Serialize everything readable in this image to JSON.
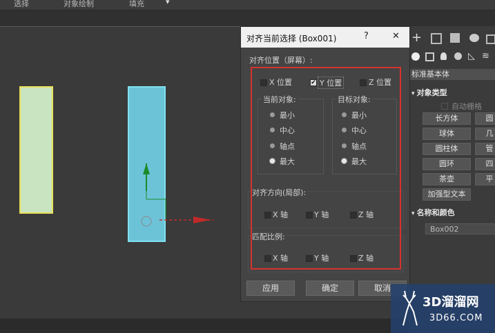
{
  "menu": {
    "items": [
      "选择",
      "对象绘制",
      "填充"
    ]
  },
  "dialog": {
    "title": "对齐当前选择 (Box001)",
    "help": "?",
    "close": "✕",
    "align_position_label": "对齐位置（屏幕）:",
    "axes": {
      "x": "X 位置",
      "y": "Y 位置",
      "z": "Z 位置",
      "y_checked": true
    },
    "current_object": {
      "label": "当前对象:",
      "options": [
        "最小",
        "中心",
        "轴点",
        "最大"
      ],
      "selected": "最大"
    },
    "target_object": {
      "label": "目标对象:",
      "options": [
        "最小",
        "中心",
        "轴点",
        "最大"
      ],
      "selected": "最大"
    },
    "orientation_label": "对齐方向(局部):",
    "orientation_axes": [
      "X 轴",
      "Y 轴",
      "Z 轴"
    ],
    "scale_label": "匹配比例:",
    "scale_axes": [
      "X 轴",
      "Y 轴",
      "Z 轴"
    ],
    "buttons": {
      "apply": "应用",
      "ok": "确定",
      "cancel": "取消"
    }
  },
  "panel": {
    "dropdown": "标准基本体",
    "object_type_header": "对象类型",
    "autogrid": "自动栅格",
    "objects": [
      "长方体",
      "圆",
      "球体",
      "几",
      "圆柱体",
      "管",
      "圆环",
      "四",
      "茶壶",
      "平"
    ],
    "extended_text": "加强型文本",
    "name_color_header": "名称和颜色",
    "name_value": "Box002"
  },
  "watermark": {
    "brand": "3D溜溜网",
    "url": "3D66.COM"
  },
  "colors": {
    "highlight": "#d8322e",
    "box_left": "#c9e4c0",
    "box_left_border": "#e8e05a",
    "box_right": "#6cc3d8",
    "box_right_border": "#7fe0f0"
  }
}
